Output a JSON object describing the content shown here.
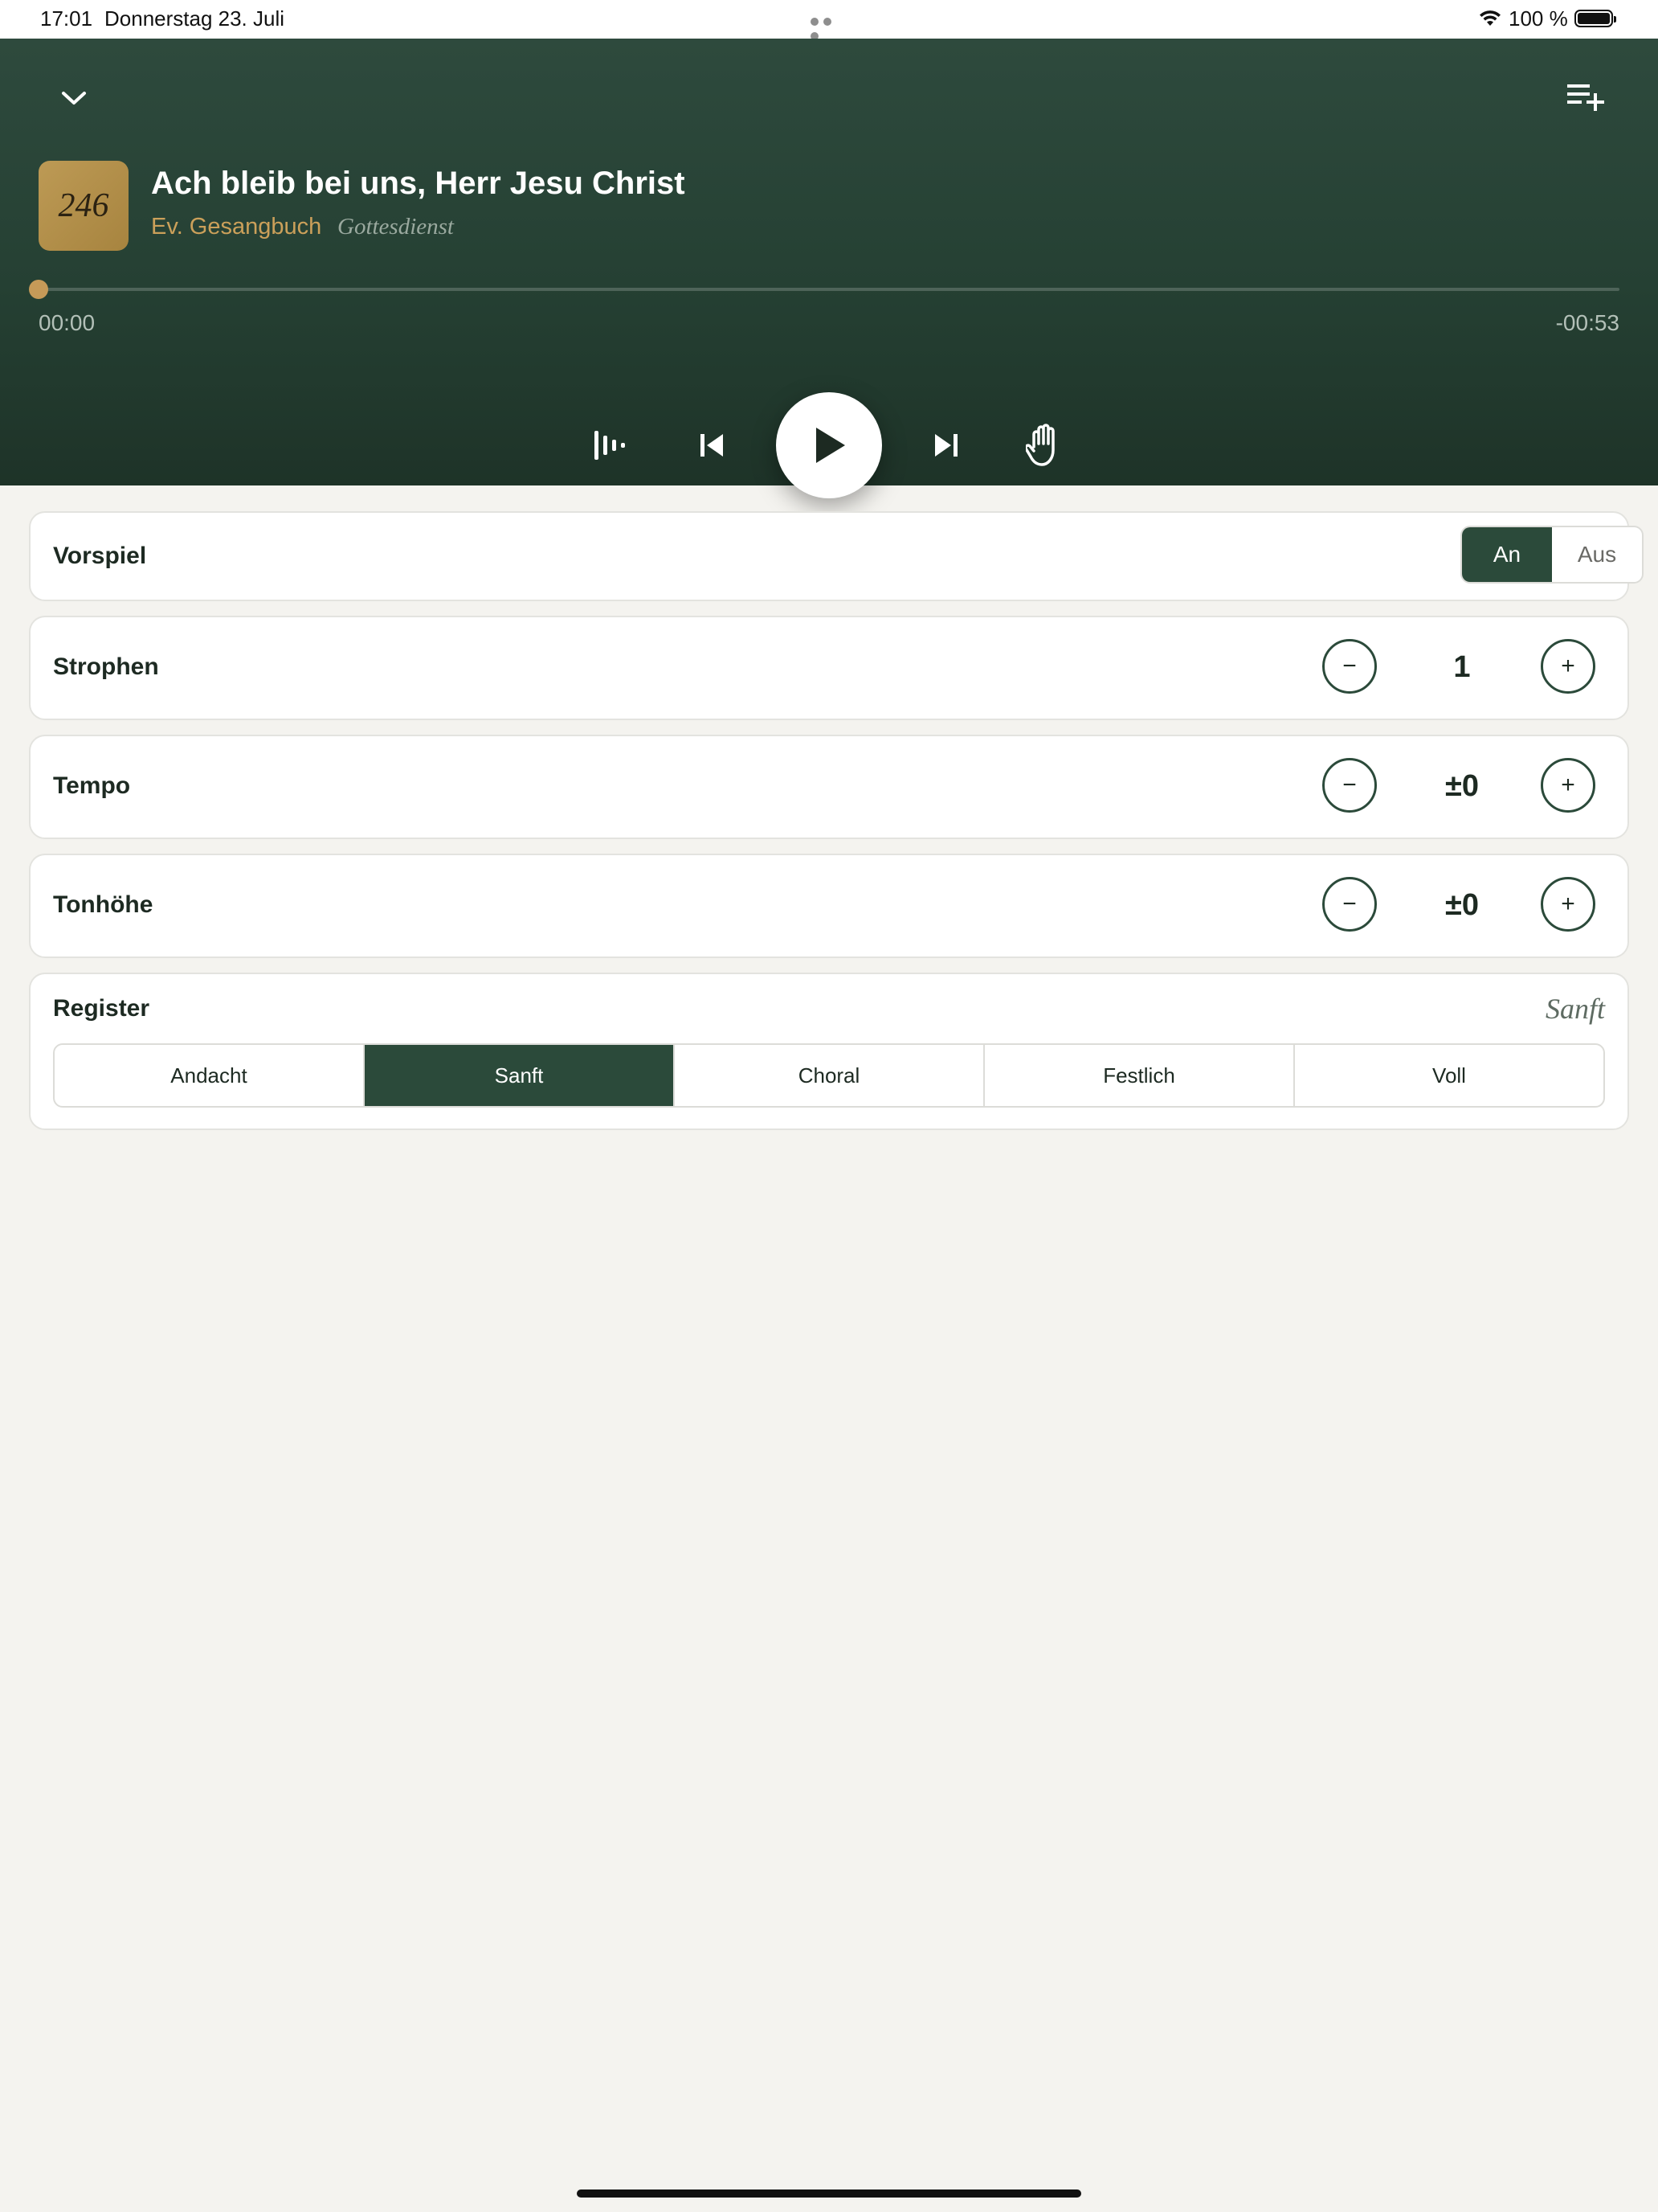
{
  "status_bar": {
    "time": "17:01",
    "date": "Donnerstag 23. Juli",
    "battery_percent": "100 %"
  },
  "player": {
    "hymn_number": "246",
    "title": "Ach bleib bei uns, Herr Jesu Christ",
    "book": "Ev. Gesangbuch",
    "occasion": "Gottesdienst",
    "elapsed": "00:00",
    "remaining": "-00:53",
    "progress": 0.0,
    "controls": [
      "equalizer-icon",
      "skip-previous-icon",
      "play-icon",
      "skip-next-icon",
      "stop-hand-icon"
    ],
    "top_icons": [
      "chevron-down-icon",
      "playlist-add-icon"
    ]
  },
  "settings": {
    "vorspiel": {
      "label": "Vorspiel",
      "on_label": "An",
      "off_label": "Aus",
      "selected": "An"
    },
    "strophen": {
      "label": "Strophen",
      "value": "1",
      "minus": "−",
      "plus": "+"
    },
    "tempo": {
      "label": "Tempo",
      "value": "±0",
      "minus": "−",
      "plus": "+"
    },
    "tonhoehe": {
      "label": "Tonhöhe",
      "value": "±0",
      "minus": "−",
      "plus": "+"
    },
    "register": {
      "label": "Register",
      "current": "Sanft",
      "options": [
        "Andacht",
        "Sanft",
        "Choral",
        "Festlich",
        "Voll"
      ],
      "selected_index": 1
    }
  },
  "colors": {
    "header_top": "#2e4a3d",
    "header_bottom": "#1e3328",
    "accent_gold": "#c59a58",
    "active_green": "#2b4a3a",
    "background": "#f4f3ef"
  }
}
